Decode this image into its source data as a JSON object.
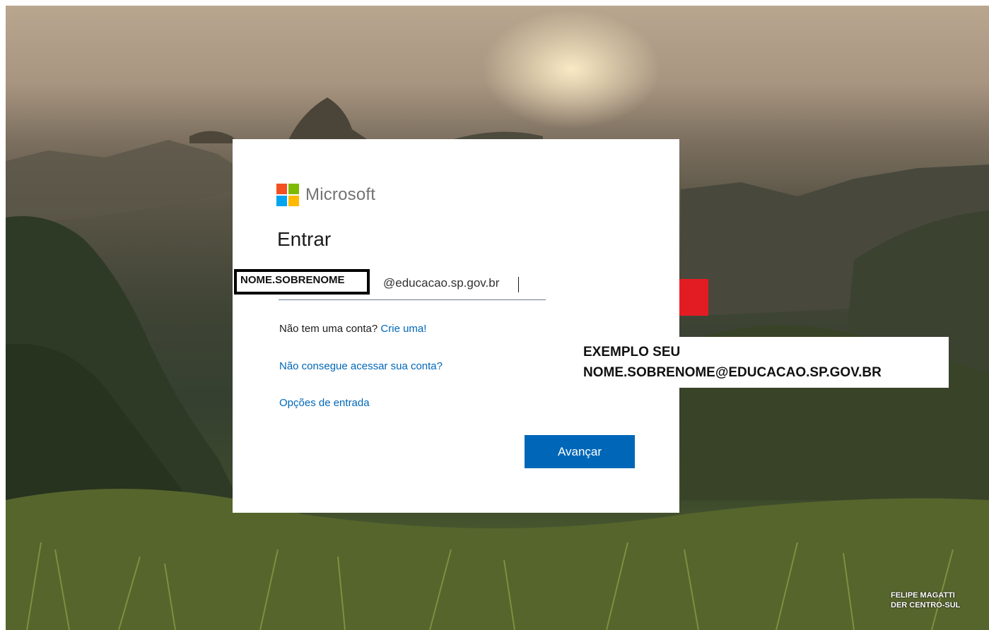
{
  "brand": {
    "name": "Microsoft",
    "logo_colors": [
      "#f25022",
      "#7fba00",
      "#00a4ef",
      "#ffb900"
    ]
  },
  "signin": {
    "title": "Entrar",
    "username_value": "NOME.SOBRENOME",
    "domain_value": "@educacao.sp.gov.br",
    "no_account_text": "Não tem uma conta?",
    "create_link": "Crie uma!",
    "cant_access_link": "Não consegue acessar sua conta?",
    "options_link": "Opções de entrada",
    "next_button": "Avançar"
  },
  "annotation": {
    "line1": "EXEMPLO SEU",
    "line2": "NOME.SOBRENOME@EDUCACAO.SP.GOV.BR",
    "arrow_color": "#e31c23"
  },
  "credit": {
    "line1": "FELIPE MAGATTI",
    "line2": "DER CENTRO-SUL"
  },
  "colors": {
    "accent": "#0067b8"
  }
}
